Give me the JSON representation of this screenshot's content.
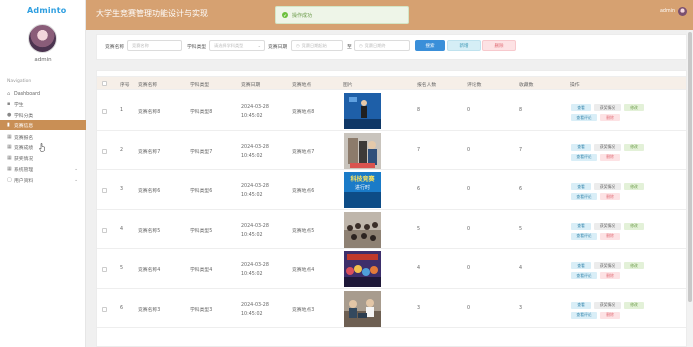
{
  "brand": {
    "logo": "Adminto"
  },
  "sidebar": {
    "username": "admin",
    "nav_title": "Navigation",
    "items": [
      {
        "label": "Dashboard",
        "icon": "home-icon",
        "glyph": "⌂"
      },
      {
        "label": "学生",
        "icon": "user-icon",
        "glyph": "▪"
      },
      {
        "label": "学科分类",
        "icon": "pin-icon",
        "glyph": "●"
      },
      {
        "label": "竞赛信息",
        "icon": "chart-icon",
        "glyph": "▮",
        "active": true
      },
      {
        "label": "竞赛报名",
        "icon": "grid-icon",
        "glyph": "▦"
      },
      {
        "label": "竞赛成绩",
        "icon": "grid-icon",
        "glyph": "▦"
      },
      {
        "label": "获奖情况",
        "icon": "grid-icon",
        "glyph": "▦"
      },
      {
        "label": "系统管理",
        "icon": "grid-icon",
        "glyph": "▦",
        "expandable": true
      },
      {
        "label": "用户资料",
        "icon": "user-file-icon",
        "glyph": "▢",
        "expandable": true
      }
    ]
  },
  "header": {
    "title": "大学生竞赛管理功能设计与实现",
    "toast": "操作成功",
    "user": "admin"
  },
  "search": {
    "name_label": "竞赛名称",
    "name_placeholder": "竞赛名称",
    "type_label": "学科类型",
    "type_placeholder": "请选择学科类型",
    "date_label": "竞赛日期",
    "date_from_placeholder": "竞赛日期起始",
    "date_sep": "至",
    "date_to_placeholder": "竞赛日期终",
    "search_button": "搜索",
    "add_button": "新增",
    "delete_button": "删除"
  },
  "table": {
    "columns": [
      "序号",
      "竞赛名称",
      "学科类型",
      "竞赛日期",
      "竞赛地点",
      "图片",
      "报名人数",
      "评论数",
      "收藏数",
      "操作"
    ],
    "ops": {
      "view": "查看",
      "report": "获奖情况",
      "edit": "修改",
      "comment": "查看评论",
      "delete": "删除"
    },
    "rows": [
      {
        "idx": "1",
        "name": "竞赛名称8",
        "type": "学科类型8",
        "date": "2024-03-28 10:45:02",
        "place": "竞赛地点8",
        "signups": "8",
        "comments": "0",
        "favorites": "8",
        "image": "stage-photo"
      },
      {
        "idx": "2",
        "name": "竞赛名称7",
        "type": "学科类型7",
        "date": "2024-03-28 10:45:02",
        "place": "竞赛地点7",
        "signups": "7",
        "comments": "0",
        "favorites": "7",
        "image": "robot-photo"
      },
      {
        "idx": "3",
        "name": "竞赛名称6",
        "type": "学科类型6",
        "date": "2024-03-28 10:45:02",
        "place": "竞赛地点6",
        "signups": "6",
        "comments": "0",
        "favorites": "6",
        "image": "poster-photo",
        "image_text": [
          "科技竞赛",
          "进行时"
        ]
      },
      {
        "idx": "4",
        "name": "竞赛名称5",
        "type": "学科类型5",
        "date": "2024-03-28 10:45:02",
        "place": "竞赛地点5",
        "signups": "5",
        "comments": "0",
        "favorites": "5",
        "image": "classroom-photo"
      },
      {
        "idx": "5",
        "name": "竞赛名称4",
        "type": "学科类型4",
        "date": "2024-03-28 10:45:02",
        "place": "竞赛地点4",
        "signups": "4",
        "comments": "0",
        "favorites": "4",
        "image": "crowd-photo"
      },
      {
        "idx": "6",
        "name": "竞赛名称3",
        "type": "学科类型3",
        "date": "2024-03-28 10:45:02",
        "place": "竞赛地点3",
        "signups": "3",
        "comments": "0",
        "favorites": "3",
        "image": "lab-photo"
      }
    ]
  }
}
